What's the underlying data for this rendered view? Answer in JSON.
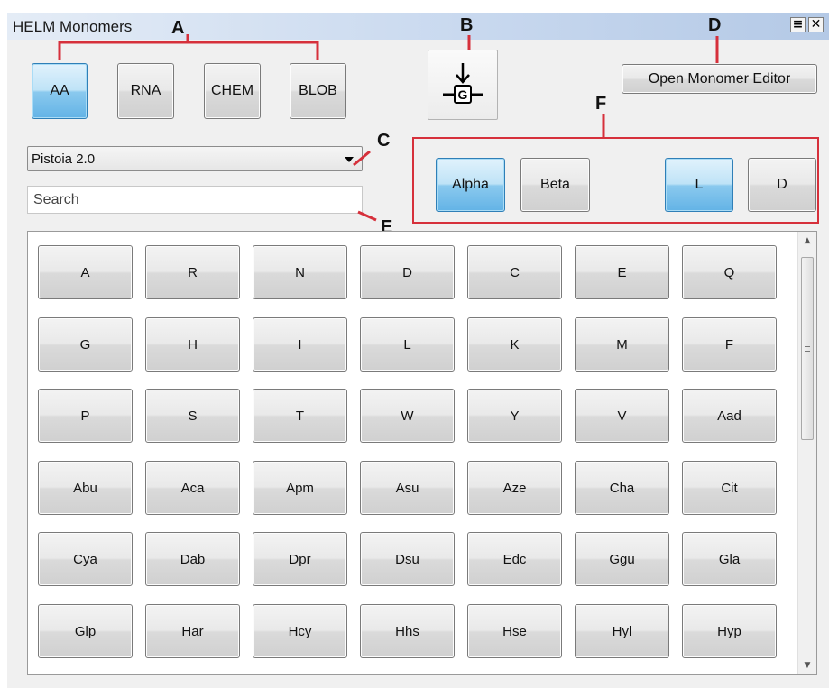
{
  "window": {
    "title": "HELM Monomers",
    "minimize_glyph": "≡",
    "close_glyph": "✕"
  },
  "polymer_types": [
    {
      "label": "AA",
      "selected": true
    },
    {
      "label": "RNA",
      "selected": false
    },
    {
      "label": "CHEM",
      "selected": false
    },
    {
      "label": "BLOB",
      "selected": false
    }
  ],
  "insert_button": {
    "icon": "insert-monomer-icon",
    "glyph_letter": "G"
  },
  "open_editor_label": "Open Monomer Editor",
  "library_dropdown": {
    "selected": "Pistoia 2.0"
  },
  "search": {
    "placeholder": "Search",
    "value": ""
  },
  "filters": {
    "alpha": {
      "label": "Alpha",
      "selected": true
    },
    "beta": {
      "label": "Beta",
      "selected": false
    },
    "l": {
      "label": "L",
      "selected": true
    },
    "d": {
      "label": "D",
      "selected": false
    }
  },
  "annotations": {
    "a": "A",
    "b": "B",
    "c": "C",
    "d": "D",
    "e": "E",
    "f": "F"
  },
  "monomers": [
    [
      "A",
      "R",
      "N",
      "D",
      "C",
      "E",
      "Q"
    ],
    [
      "G",
      "H",
      "I",
      "L",
      "K",
      "M",
      "F"
    ],
    [
      "P",
      "S",
      "T",
      "W",
      "Y",
      "V",
      "Aad"
    ],
    [
      "Abu",
      "Aca",
      "Apm",
      "Asu",
      "Aze",
      "Cha",
      "Cit"
    ],
    [
      "Cya",
      "Dab",
      "Dpr",
      "Dsu",
      "Edc",
      "Ggu",
      "Gla"
    ],
    [
      "Glp",
      "Har",
      "Hcy",
      "Hhs",
      "Hse",
      "Hyl",
      "Hyp"
    ]
  ],
  "scrollbar": {
    "up_glyph": "▲",
    "down_glyph": "▼"
  },
  "colors": {
    "selected_button": "#63b3e6",
    "annotation_red": "#d6303b",
    "titlebar": "#c9d9ef"
  }
}
